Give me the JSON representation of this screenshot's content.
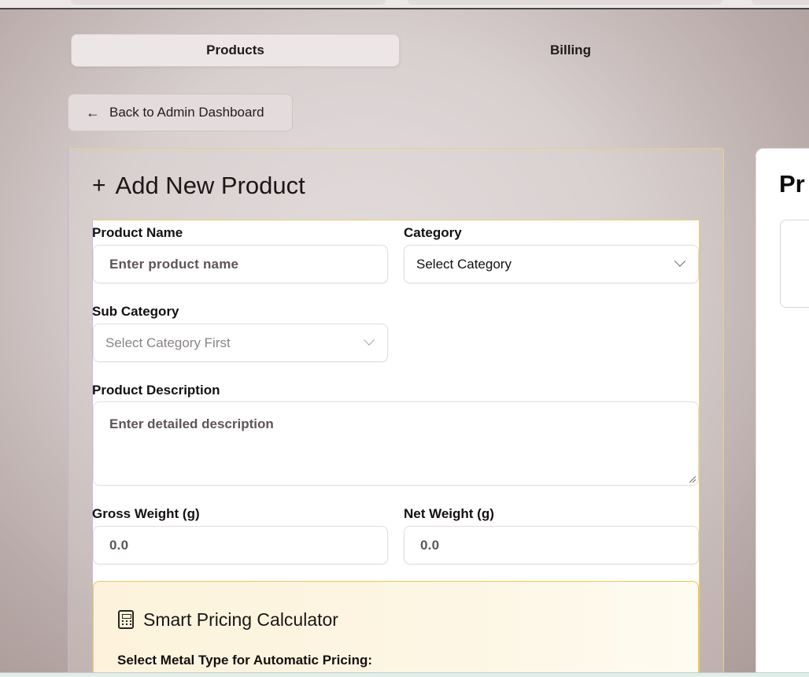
{
  "tabs": [
    {
      "label": "Products",
      "active": true
    },
    {
      "label": "Billing",
      "active": false
    }
  ],
  "back_button": {
    "label": "Back to Admin Dashboard",
    "icon": "arrow-left-icon"
  },
  "card": {
    "title": "Add New Product",
    "icon": "plus-icon"
  },
  "form": {
    "product_name": {
      "label": "Product Name",
      "placeholder": "Enter product name"
    },
    "category": {
      "label": "Category",
      "selected": "Select Category"
    },
    "sub_category": {
      "label": "Sub Category",
      "selected": "Select Category First",
      "disabled": true
    },
    "description": {
      "label": "Product Description",
      "placeholder": "Enter detailed description"
    },
    "gross_weight": {
      "label": "Gross Weight (g)",
      "placeholder": "0.0"
    },
    "net_weight": {
      "label": "Net Weight (g)",
      "placeholder": "0.0"
    }
  },
  "calculator": {
    "title": "Smart Pricing Calculator",
    "icon": "calculator-icon",
    "subtitle": "Select Metal Type for Automatic Pricing:"
  },
  "right_panel": {
    "title_visible": "Pr"
  },
  "colors": {
    "calculator_border": "#ecc94f",
    "calculator_bg": "#fdf3dc"
  }
}
